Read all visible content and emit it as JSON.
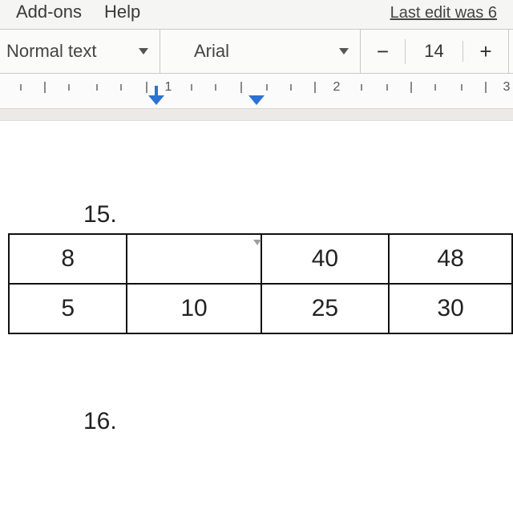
{
  "menu": {
    "addons": "Add-ons",
    "help": "Help",
    "last_edit": "Last edit was 6"
  },
  "toolbar": {
    "style": "Normal text",
    "font": "Arial",
    "size_minus": "−",
    "size_value": "14",
    "size_plus": "+"
  },
  "ruler": {
    "nums": [
      "1",
      "2",
      "3"
    ]
  },
  "doc": {
    "q15": "15.",
    "q16": "16.",
    "table": {
      "row1": {
        "c1": "8",
        "c2": "",
        "c3": "40",
        "c4": "48"
      },
      "row2": {
        "c1": "5",
        "c2": "10",
        "c3": "25",
        "c4": "30"
      }
    }
  }
}
